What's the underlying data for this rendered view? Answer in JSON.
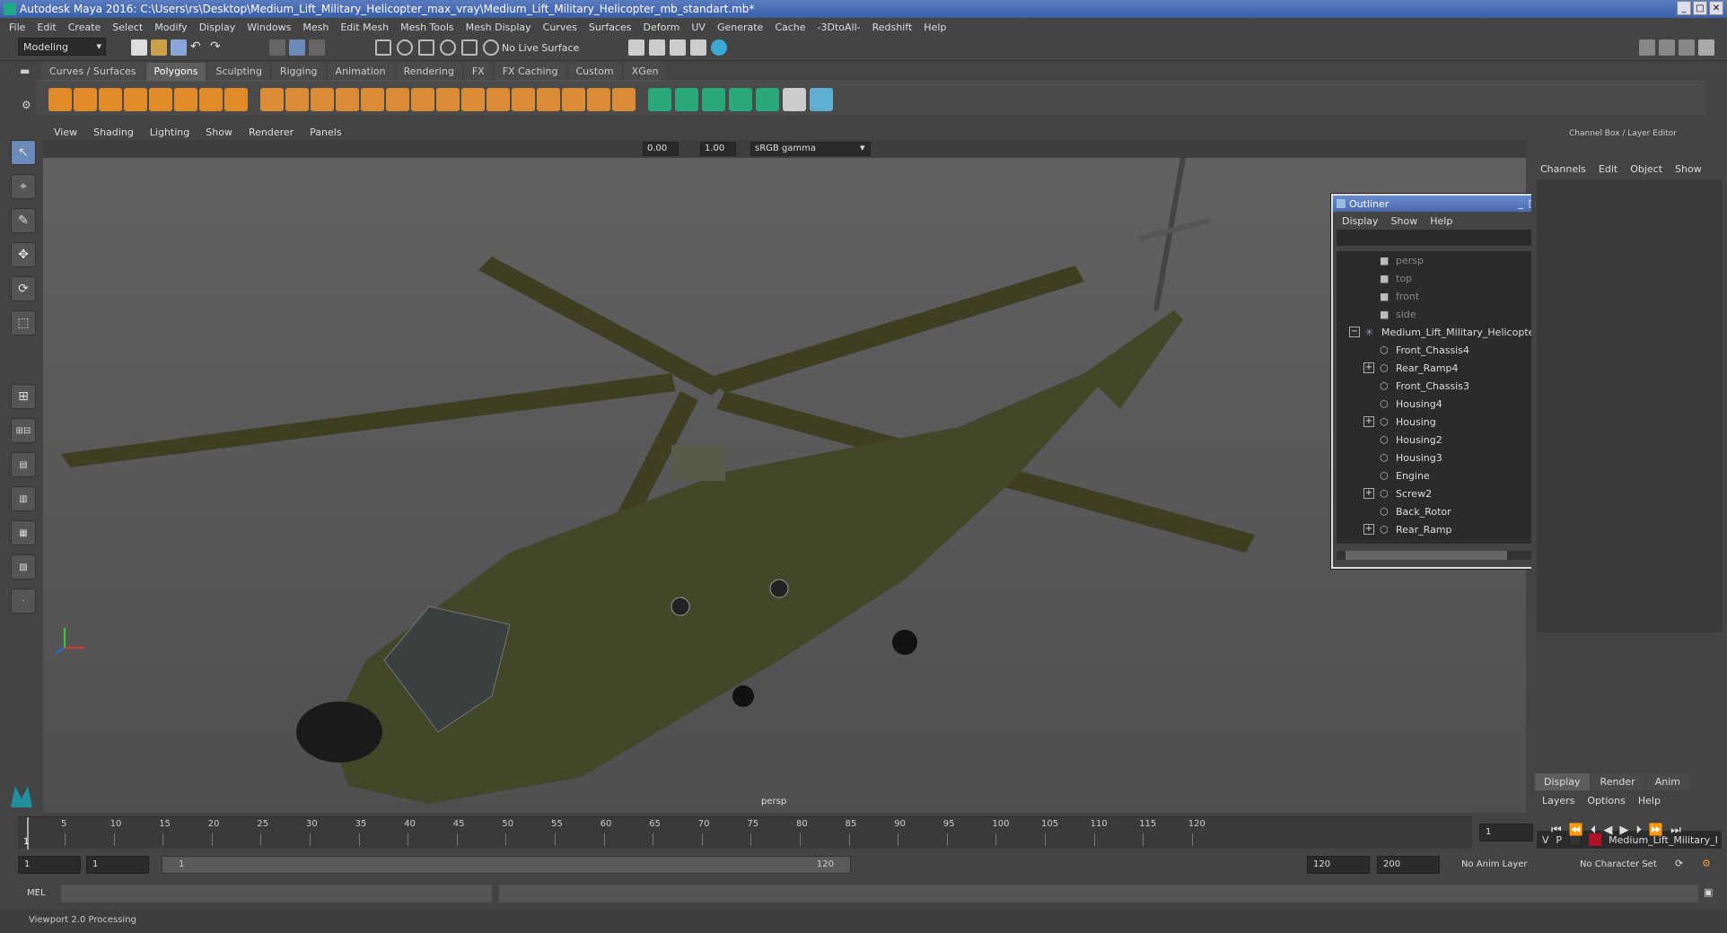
{
  "window": {
    "title": "Autodesk Maya 2016: C:\\Users\\rs\\Desktop\\Medium_Lift_Military_Helicopter_max_vray\\Medium_Lift_Military_Helicopter_mb_standart.mb*"
  },
  "menubar": [
    "File",
    "Edit",
    "Create",
    "Select",
    "Modify",
    "Display",
    "Windows",
    "Mesh",
    "Edit Mesh",
    "Mesh Tools",
    "Mesh Display",
    "Curves",
    "Surfaces",
    "Deform",
    "UV",
    "Generate",
    "Cache",
    "-3DtoAll-",
    "Redshift",
    "Help"
  ],
  "toolbar": {
    "mode": "Modeling",
    "live_surface": "No Live Surface"
  },
  "shelf_tabs": [
    "Curves / Surfaces",
    "Polygons",
    "Sculpting",
    "Rigging",
    "Animation",
    "Rendering",
    "FX",
    "FX Caching",
    "Custom",
    "XGen"
  ],
  "shelf_active": "Polygons",
  "panel_menu": [
    "View",
    "Shading",
    "Lighting",
    "Show",
    "Renderer",
    "Panels"
  ],
  "viewport": {
    "exposure": "0.00",
    "gamma": "1.00",
    "color_space": "sRGB gamma",
    "camera_label": "persp"
  },
  "outliner": {
    "title": "Outliner",
    "menu": [
      "Display",
      "Show",
      "Help"
    ],
    "items": [
      {
        "label": "persp",
        "icon": "camera-icon",
        "dim": true,
        "indent": 2,
        "expander": ""
      },
      {
        "label": "top",
        "icon": "camera-icon",
        "dim": true,
        "indent": 2,
        "expander": ""
      },
      {
        "label": "front",
        "icon": "camera-icon",
        "dim": true,
        "indent": 2,
        "expander": ""
      },
      {
        "label": "side",
        "icon": "camera-icon",
        "dim": true,
        "indent": 2,
        "expander": ""
      },
      {
        "label": "Medium_Lift_Military_Helicopter_",
        "icon": "group-icon",
        "dim": false,
        "indent": 1,
        "expander": "−"
      },
      {
        "label": "Front_Chassis4",
        "icon": "mesh-icon",
        "dim": false,
        "indent": 2,
        "expander": ""
      },
      {
        "label": "Rear_Ramp4",
        "icon": "mesh-icon",
        "dim": false,
        "indent": 2,
        "expander": "+"
      },
      {
        "label": "Front_Chassis3",
        "icon": "mesh-icon",
        "dim": false,
        "indent": 2,
        "expander": ""
      },
      {
        "label": "Housing4",
        "icon": "mesh-icon",
        "dim": false,
        "indent": 2,
        "expander": ""
      },
      {
        "label": "Housing",
        "icon": "mesh-icon",
        "dim": false,
        "indent": 2,
        "expander": "+"
      },
      {
        "label": "Housing2",
        "icon": "mesh-icon",
        "dim": false,
        "indent": 2,
        "expander": ""
      },
      {
        "label": "Housing3",
        "icon": "mesh-icon",
        "dim": false,
        "indent": 2,
        "expander": ""
      },
      {
        "label": "Engine",
        "icon": "mesh-icon",
        "dim": false,
        "indent": 2,
        "expander": ""
      },
      {
        "label": "Screw2",
        "icon": "mesh-icon",
        "dim": false,
        "indent": 2,
        "expander": "+"
      },
      {
        "label": "Back_Rotor",
        "icon": "mesh-icon",
        "dim": false,
        "indent": 2,
        "expander": ""
      },
      {
        "label": "Rear_Ramp",
        "icon": "mesh-icon",
        "dim": false,
        "indent": 2,
        "expander": "+"
      }
    ]
  },
  "channelbox": {
    "title": "Channel Box / Layer Editor",
    "menu": [
      "Channels",
      "Edit",
      "Object",
      "Show"
    ],
    "layer_tabs": [
      "Display",
      "Render",
      "Anim"
    ],
    "layer_menu": [
      "Layers",
      "Options",
      "Help"
    ],
    "layer": {
      "v": "V",
      "p": "P",
      "name": "Medium_Lift_Military_I",
      "color": "#b0102a"
    }
  },
  "timeline": {
    "ticks": [
      "5",
      "10",
      "15",
      "20",
      "25",
      "30",
      "35",
      "40",
      "45",
      "50",
      "55",
      "60",
      "65",
      "70",
      "75",
      "80",
      "85",
      "90",
      "95",
      "100",
      "105",
      "110",
      "115",
      "120"
    ],
    "current": "1",
    "frame_field": "1"
  },
  "range": {
    "start": "1",
    "start2": "1",
    "slider_start": "1",
    "slider_end": "120",
    "end": "120",
    "end2": "200",
    "anim_layer": "No Anim Layer",
    "character_set": "No Character Set"
  },
  "cmd": {
    "label": "MEL"
  },
  "status": "Viewport 2.0 Processing"
}
